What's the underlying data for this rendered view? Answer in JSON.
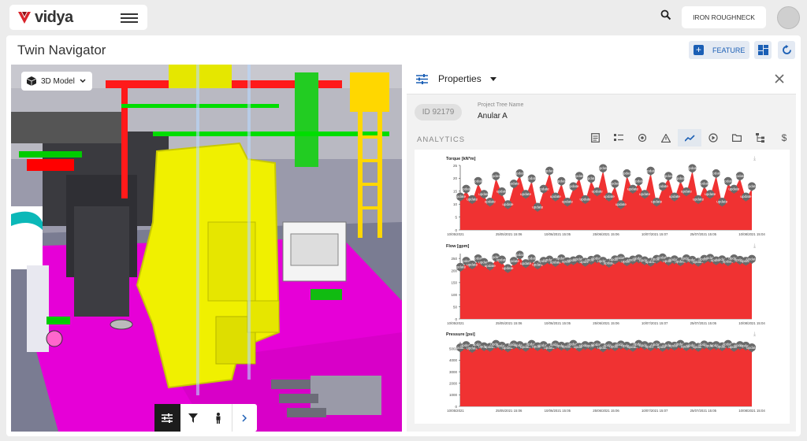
{
  "app": {
    "logo_text": "vidya",
    "user_label": "IRON ROUGHNECK"
  },
  "page": {
    "title": "Twin Navigator",
    "feature_label": "FEATURE"
  },
  "viewer": {
    "mode_label": "3D Model"
  },
  "properties": {
    "title": "Properties",
    "id_badge": "ID 92179",
    "project_tree_label": "Project Tree Name",
    "project_tree_value": "Anular A",
    "section_label": "ANALYTICS"
  },
  "colors": {
    "accent": "#1b5fb5",
    "series_fill": "#f03232",
    "annotation": "#6a6a6a"
  },
  "chart_data": [
    {
      "type": "area",
      "title": "Torque [kN*m]",
      "xlabels": [
        "10/05/2021",
        "25/05/2021 15:06",
        "10/06/2021 15:05",
        "25/06/2021 15:06",
        "10/07/2021 15:07",
        "25/07/2021 15:05",
        "10/08/2021 15:04"
      ],
      "yticks": [
        0,
        5,
        10,
        15,
        20,
        25
      ],
      "ylim": [
        0,
        25
      ],
      "values": [
        12,
        15,
        11,
        18,
        13,
        10,
        20,
        14,
        9,
        17,
        21,
        13,
        19,
        8,
        15,
        22,
        12,
        18,
        10,
        16,
        20,
        11,
        19,
        14,
        23,
        12,
        17,
        9,
        21,
        15,
        18,
        13,
        22,
        10,
        16,
        20,
        12,
        19,
        14,
        23,
        11,
        17,
        13,
        21,
        10,
        18,
        15,
        20,
        12,
        16
      ],
      "annotation_label": "update"
    },
    {
      "type": "area",
      "title": "Flow [gpm]",
      "xlabels": [
        "10/05/2021",
        "25/05/2021 15:06",
        "10/06/2021 15:05",
        "25/06/2021 15:06",
        "10/07/2021 15:07",
        "25/07/2021 15:05",
        "10/08/2021 15:04"
      ],
      "yticks": [
        0,
        50,
        100,
        150,
        200,
        250
      ],
      "ylim": [
        0,
        270
      ],
      "values": [
        205,
        230,
        215,
        240,
        225,
        210,
        245,
        235,
        200,
        230,
        255,
        220,
        240,
        215,
        230,
        235,
        225,
        240,
        228,
        232,
        238,
        226,
        234,
        240,
        230,
        222,
        236,
        242,
        228,
        235,
        240,
        232,
        226,
        238,
        244,
        230,
        236,
        228,
        240,
        234,
        226,
        238,
        242,
        232,
        236,
        228,
        240,
        234,
        230,
        238
      ],
      "annotation_label": "update"
    },
    {
      "type": "area",
      "title": "Pressure [psi]",
      "xlabels": [
        "10/05/2021",
        "25/05/2021 15:06",
        "10/06/2021 15:05",
        "25/06/2021 15:06",
        "10/07/2021 15:07",
        "25/07/2021 15:05",
        "10/08/2021 15:04"
      ],
      "yticks": [
        0,
        1000,
        2000,
        3000,
        4000,
        5000
      ],
      "ylim": [
        0,
        5600
      ],
      "values": [
        4900,
        5100,
        4850,
        5150,
        5000,
        4950,
        5200,
        5050,
        4900,
        5150,
        5100,
        4950,
        5200,
        5000,
        5100,
        4900,
        5150,
        5050,
        5000,
        5200,
        4950,
        5100,
        5050,
        5150,
        4900,
        5100,
        5000,
        5150,
        5050,
        4950,
        5200,
        5100,
        5000,
        5150,
        4950,
        5100,
        5050,
        5200,
        5000,
        5100,
        4950,
        5150,
        5050,
        5100,
        5000,
        5200,
        4950,
        5100,
        5050,
        4900
      ],
      "annotation_label": "update"
    }
  ]
}
